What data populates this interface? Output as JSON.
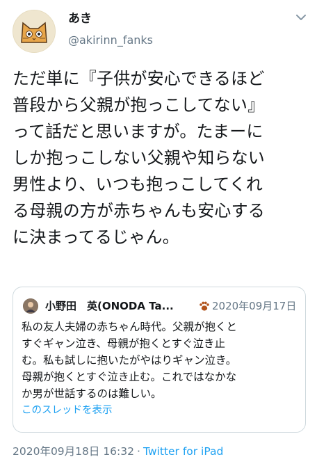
{
  "author": {
    "name": "あき",
    "handle": "@akirinn_fanks"
  },
  "tweet": {
    "lines": [
      "ただ単に『子供が安心できるほど",
      "普段から父親が抱っこしてない』",
      "って話だと思いますが。たまーに",
      "しか抱っこしない父親や知らない",
      "男性より、いつも抱っこしてくれ",
      "る母親の方が赤ちゃんも安心する",
      "に決まってるじゃん。"
    ]
  },
  "quoted": {
    "name": "小野田　英(ONODA Ta...",
    "date": "2020年09月17日",
    "lines": [
      "私の友人夫婦の赤ちゃん時代。父親が抱くと",
      "すぐギャン泣き、母親が抱くとすぐ泣き止",
      "む。私も試しに抱いたがやはりギャン泣き。",
      "母親が抱くとすぐ泣き止む。これではなかな",
      "か男が世話するのは難しい。"
    ],
    "show_thread": "このスレッドを表示"
  },
  "meta": {
    "timestamp": "2020年09月18日 16:32",
    "separator": "·",
    "source": "Twitter for iPad"
  },
  "colors": {
    "accent": "#1da1f2",
    "muted": "#657786",
    "border": "#cfd9de"
  }
}
